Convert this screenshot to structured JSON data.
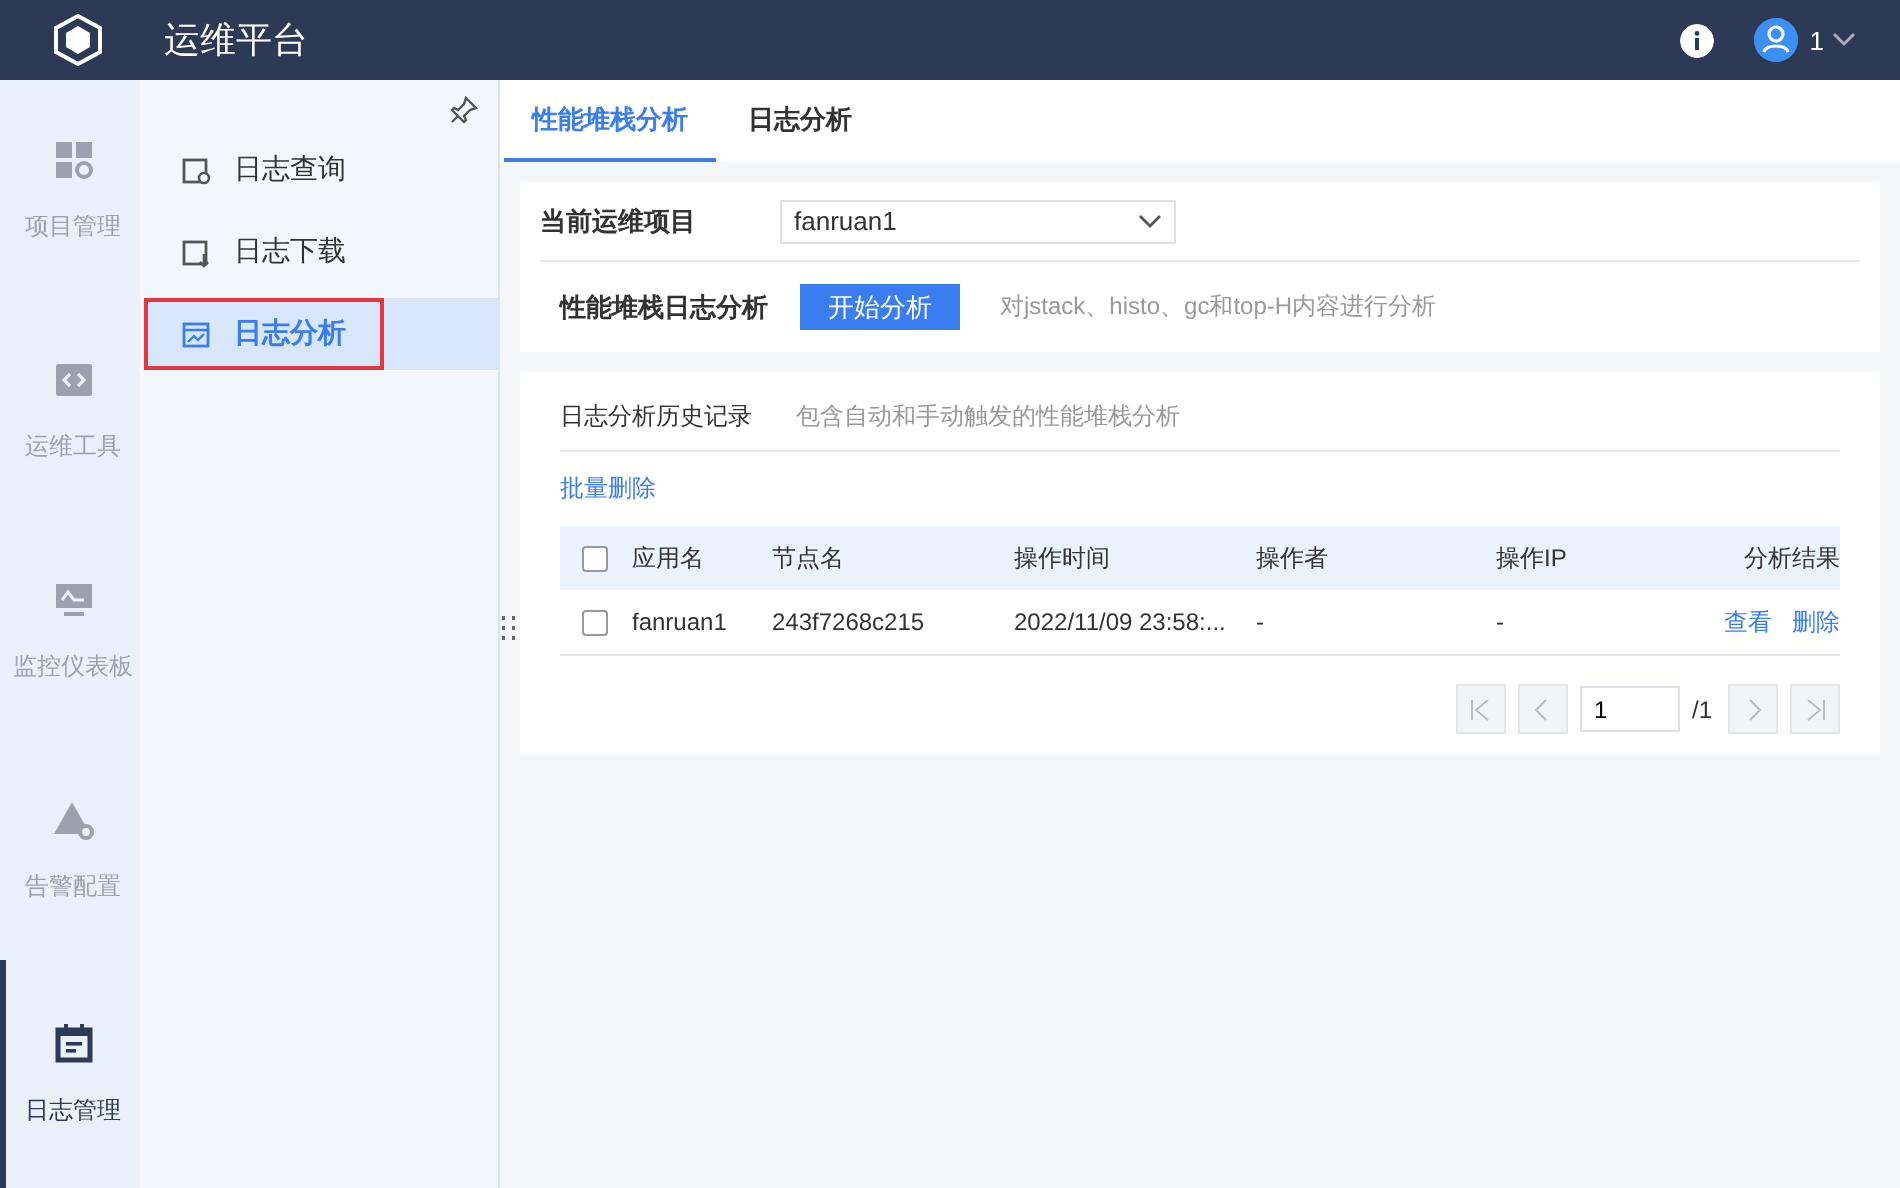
{
  "header": {
    "title": "运维平台",
    "user": "1"
  },
  "nav_rail": [
    {
      "label": "项目管理",
      "selected": false
    },
    {
      "label": "运维工具",
      "selected": false
    },
    {
      "label": "监控仪表板",
      "selected": false
    },
    {
      "label": "告警配置",
      "selected": false
    },
    {
      "label": "日志管理",
      "selected": true
    }
  ],
  "submenu": [
    {
      "label": "日志查询",
      "selected": false
    },
    {
      "label": "日志下载",
      "selected": false
    },
    {
      "label": "日志分析",
      "selected": true
    }
  ],
  "tabs": [
    {
      "label": "性能堆栈分析",
      "selected": true
    },
    {
      "label": "日志分析",
      "selected": false
    }
  ],
  "project": {
    "label": "当前运维项目",
    "value": "fanruan1"
  },
  "analysis": {
    "label": "性能堆栈日志分析",
    "button": "开始分析",
    "hint": "对jstack、histo、gc和top-H内容进行分析"
  },
  "history": {
    "title": "日志分析历史记录",
    "subtitle": "包含自动和手动触发的性能堆栈分析",
    "batch_delete": "批量删除",
    "select_all": false,
    "columns": [
      "应用名",
      "节点名",
      "操作时间",
      "操作者",
      "操作IP",
      "分析结果"
    ],
    "rows": [
      {
        "checked": false,
        "cells": [
          "fanruan1",
          "243f7268c215",
          "2022/11/09 23:58:...",
          "-",
          "-"
        ],
        "actions": [
          "查看",
          "删除"
        ]
      }
    ]
  },
  "pagination": {
    "page": "1",
    "total": "/1"
  }
}
